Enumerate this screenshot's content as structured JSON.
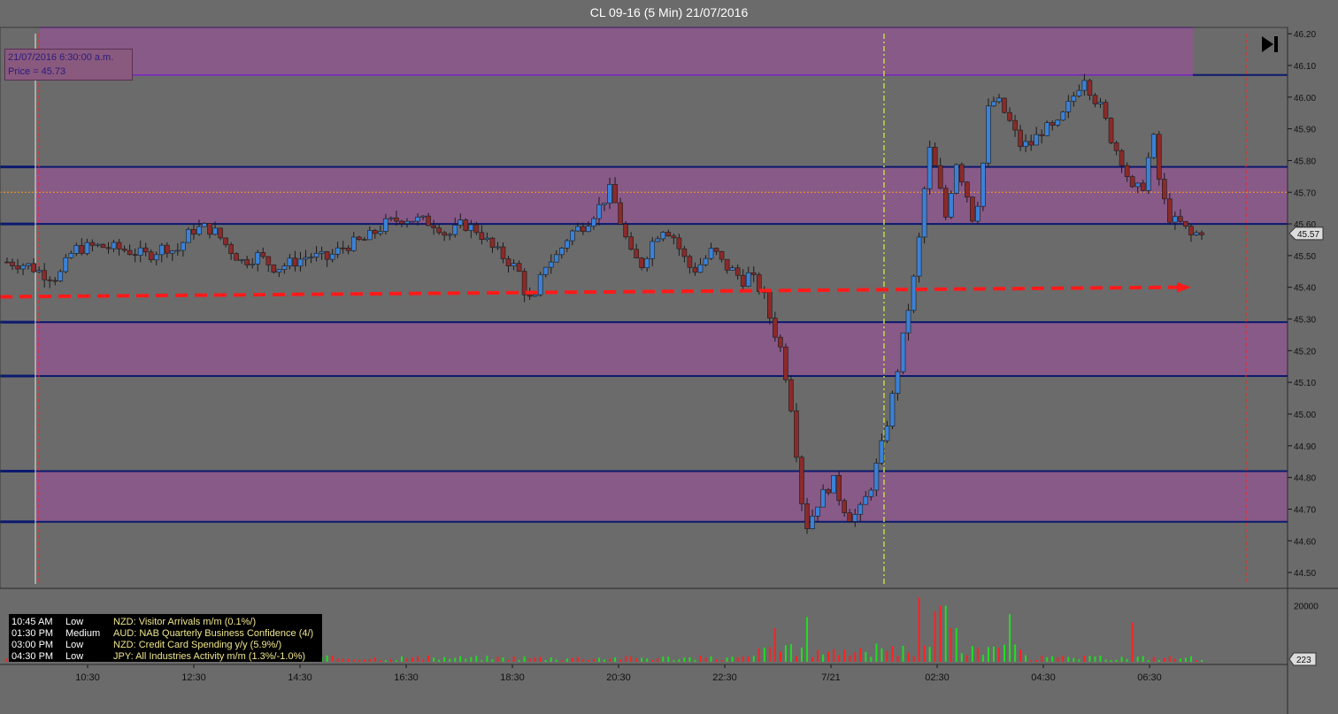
{
  "window": {
    "title": "CL 09-16 (5 Min)  21/07/2016"
  },
  "crosshair": {
    "line1": "21/07/2016 6:30:00 a.m.",
    "line2": "Price = 45.73"
  },
  "toolbar": {
    "skip_to_end_icon": "skip-to-end-icon"
  },
  "price_axis": {
    "ticks": [
      "46.20",
      "46.10",
      "46.00",
      "45.90",
      "45.80",
      "45.70",
      "45.60",
      "45.50",
      "45.40",
      "45.30",
      "45.20",
      "45.10",
      "45.00",
      "44.90",
      "44.80",
      "44.70",
      "44.60",
      "44.50"
    ],
    "current_price_label": "45.57"
  },
  "time_axis": {
    "ticks": [
      "10:30",
      "12:30",
      "14:30",
      "16:30",
      "18:30",
      "20:30",
      "22:30",
      "7/21",
      "02:30",
      "04:30",
      "06:30"
    ]
  },
  "volume_axis": {
    "tick": "20000",
    "current_volume_label": "223"
  },
  "news": [
    {
      "time": "10:45 AM",
      "impact": "Low",
      "event": "NZD: Visitor Arrivals m/m (0.1%/)"
    },
    {
      "time": "01:30 PM",
      "impact": "Medium",
      "event": "AUD: NAB Quarterly Business Confidence (4/)"
    },
    {
      "time": "03:00 PM",
      "impact": "Low",
      "event": "NZD: Credit Card Spending y/y (5.9%/)"
    },
    {
      "time": "04:30 PM",
      "impact": "Low",
      "event": "JPY: All Industries Activity m/m (1.3%/-1.0%)"
    }
  ],
  "colors": {
    "background": "#6b6b6b",
    "zone_fill": "#8a5a8a",
    "zone_border": "#7a22c4",
    "level_line": "#0b1a6e",
    "up_candle": "#3a82d8",
    "down_candle": "#8b2a2a",
    "trend_arrow": "#ff1a1a",
    "current_price_line": "#ff9a1a",
    "session_line": "#ff2020",
    "day_line": "#c8d64a",
    "volume_up": "#22dd22",
    "volume_down": "#ff2020"
  },
  "chart_data": {
    "type": "candlestick",
    "instrument": "CL 09-16",
    "interval": "5 Min",
    "ylim": [
      44.45,
      46.22
    ],
    "x_ticks": [
      "10:30",
      "12:30",
      "14:30",
      "16:30",
      "18:30",
      "20:30",
      "22:30",
      "7/21",
      "02:30",
      "04:30",
      "06:30"
    ],
    "zones": [
      {
        "from": 46.07,
        "to": 46.22
      },
      {
        "from": 45.6,
        "to": 45.78
      },
      {
        "from": 45.12,
        "to": 45.29
      },
      {
        "from": 44.66,
        "to": 44.82
      }
    ],
    "levels": [
      46.07,
      45.78,
      45.6,
      45.29,
      45.12,
      44.82,
      44.66
    ],
    "current_price": 45.7,
    "crosshair_price": 45.73,
    "trend_arrow": {
      "start_price": 45.37,
      "end_price": 45.4
    },
    "path": [
      [
        0,
        45.48
      ],
      [
        8,
        45.47
      ],
      [
        15,
        45.44
      ],
      [
        20,
        45.43
      ],
      [
        26,
        45.52
      ],
      [
        35,
        45.53
      ],
      [
        45,
        45.52
      ],
      [
        55,
        45.5
      ],
      [
        62,
        45.53
      ],
      [
        66,
        45.51
      ],
      [
        72,
        45.58
      ],
      [
        78,
        45.59
      ],
      [
        82,
        45.57
      ],
      [
        86,
        45.53
      ],
      [
        92,
        45.48
      ],
      [
        98,
        45.5
      ],
      [
        105,
        45.46
      ],
      [
        112,
        45.48
      ],
      [
        118,
        45.5
      ],
      [
        125,
        45.49
      ],
      [
        132,
        45.53
      ],
      [
        140,
        45.55
      ],
      [
        148,
        45.6
      ],
      [
        155,
        45.62
      ],
      [
        162,
        45.61
      ],
      [
        168,
        45.6
      ],
      [
        172,
        45.56
      ],
      [
        178,
        45.6
      ],
      [
        184,
        45.58
      ],
      [
        190,
        45.52
      ],
      [
        195,
        45.49
      ],
      [
        200,
        45.45
      ],
      [
        203,
        45.37
      ],
      [
        206,
        45.35
      ],
      [
        210,
        45.47
      ],
      [
        215,
        45.5
      ],
      [
        220,
        45.57
      ],
      [
        226,
        45.6
      ],
      [
        232,
        45.66
      ],
      [
        236,
        45.71
      ],
      [
        240,
        45.6
      ],
      [
        244,
        45.5
      ],
      [
        248,
        45.47
      ],
      [
        252,
        45.54
      ],
      [
        256,
        45.59
      ],
      [
        260,
        45.57
      ],
      [
        264,
        45.5
      ],
      [
        268,
        45.45
      ],
      [
        272,
        45.48
      ],
      [
        276,
        45.52
      ],
      [
        280,
        45.47
      ],
      [
        284,
        45.45
      ],
      [
        288,
        45.42
      ],
      [
        290,
        45.44
      ],
      [
        293,
        45.41
      ],
      [
        296,
        45.37
      ],
      [
        299,
        45.28
      ],
      [
        302,
        45.22
      ],
      [
        305,
        45.1
      ],
      [
        307,
        45.0
      ],
      [
        309,
        44.85
      ],
      [
        311,
        44.7
      ],
      [
        313,
        44.64
      ],
      [
        316,
        44.71
      ],
      [
        320,
        44.76
      ],
      [
        323,
        44.79
      ],
      [
        326,
        44.72
      ],
      [
        330,
        44.67
      ],
      [
        334,
        44.7
      ],
      [
        338,
        44.78
      ],
      [
        342,
        44.9
      ],
      [
        346,
        45.05
      ],
      [
        349,
        45.18
      ],
      [
        352,
        45.32
      ],
      [
        355,
        45.45
      ],
      [
        358,
        45.65
      ],
      [
        360,
        45.85
      ],
      [
        363,
        45.77
      ],
      [
        367,
        45.62
      ],
      [
        371,
        45.8
      ],
      [
        375,
        45.7
      ],
      [
        378,
        45.6
      ],
      [
        381,
        45.75
      ],
      [
        384,
        45.99
      ],
      [
        388,
        45.98
      ],
      [
        392,
        45.92
      ],
      [
        396,
        45.85
      ],
      [
        400,
        45.85
      ],
      [
        405,
        45.9
      ],
      [
        410,
        45.9
      ],
      [
        414,
        45.96
      ],
      [
        418,
        46.02
      ],
      [
        421,
        46.07
      ],
      [
        424,
        46.01
      ],
      [
        428,
        45.96
      ],
      [
        432,
        45.86
      ],
      [
        436,
        45.8
      ],
      [
        440,
        45.7
      ],
      [
        444,
        45.72
      ],
      [
        448,
        45.88
      ],
      [
        451,
        45.7
      ],
      [
        455,
        45.61
      ],
      [
        459,
        45.6
      ],
      [
        463,
        45.56
      ],
      [
        467,
        45.58
      ]
    ],
    "volume_spikes": [
      {
        "x": 300,
        "value": 12000
      },
      {
        "x": 312,
        "value": 16000
      },
      {
        "x": 357,
        "value": 23000
      },
      {
        "x": 362,
        "value": 18000
      },
      {
        "x": 366,
        "value": 20000
      },
      {
        "x": 370,
        "value": 12000
      },
      {
        "x": 392,
        "value": 17000
      },
      {
        "x": 440,
        "value": 14000
      }
    ]
  }
}
